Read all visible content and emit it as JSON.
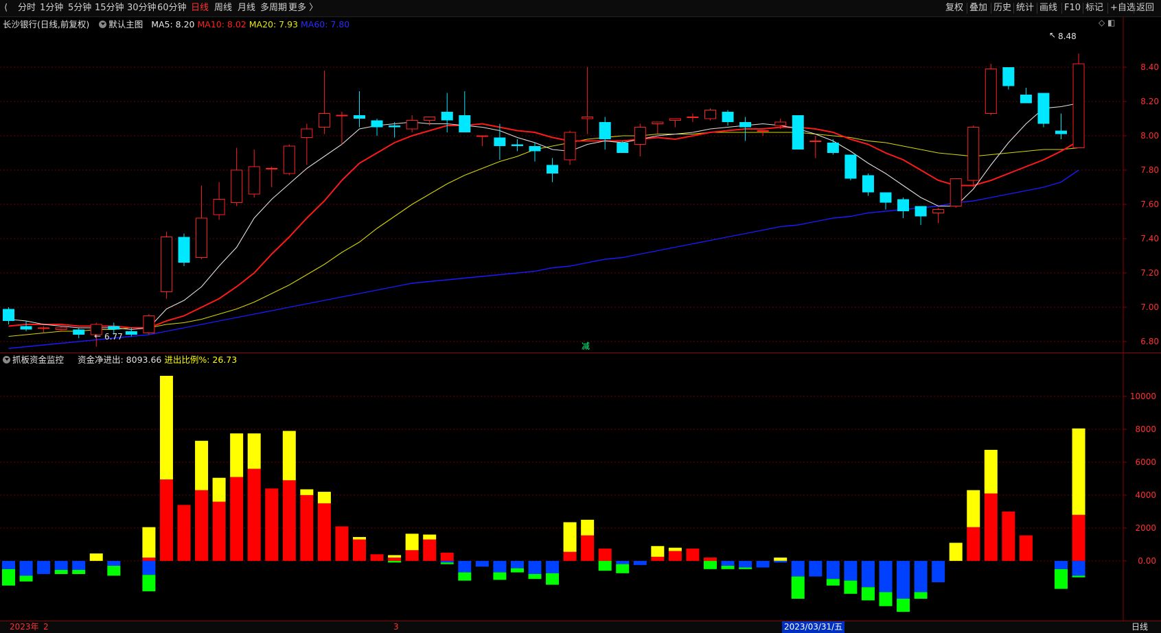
{
  "toolbar": {
    "periods": [
      "分时",
      "1分钟",
      "5分钟",
      "15分钟",
      "30分钟",
      "60分钟",
      "日线",
      "周线",
      "月线",
      "多周期",
      "更多 〉"
    ],
    "active_period": "日线",
    "right_buttons": [
      "复权",
      "叠加",
      "历史",
      "统计",
      "画线",
      "F10",
      "标记",
      "+自选",
      "返回"
    ]
  },
  "legend": {
    "stock": "长沙银行(日线,前复权)",
    "template": "默认主图",
    "ma5": "MA5: 8.20",
    "ma10": "MA10: 8.02",
    "ma20": "MA20: 7.93",
    "ma60": "MA60: 7.80",
    "sub_name": "抓板资金监控",
    "sub_net": "资金净进出: 8093.66",
    "sub_ratio": "进出比例%: 26.73"
  },
  "annotations": {
    "high_label": "8.48",
    "low_label": "6.77",
    "marker": "减"
  },
  "bottom": {
    "year": "2023年",
    "m2": "2",
    "m3": "3",
    "cursor_date": "2023/03/31/五",
    "period": "日线"
  },
  "colors": {
    "up": "#ff2020",
    "down": "#00e8ff",
    "ma5": "#e0e0e0",
    "ma10": "#ff1a1a",
    "ma20": "#d8d800",
    "ma60": "#1a1aff",
    "bar_red": "#ff0000",
    "bar_yellow": "#ffff00",
    "bar_blue": "#0040ff",
    "bar_green": "#00ff00"
  },
  "chart_data": [
    {
      "type": "candlestick",
      "title": "长沙银行(日线,前复权)",
      "y_ticks": [
        "8.40",
        "8.20",
        "8.00",
        "7.80",
        "7.60",
        "7.40",
        "7.20",
        "7.00",
        "6.80"
      ],
      "ylim": [
        6.74,
        8.56
      ],
      "ohlc": [
        [
          6.99,
          7.0,
          6.9,
          6.92
        ],
        [
          6.89,
          6.92,
          6.86,
          6.87
        ],
        [
          6.88,
          6.89,
          6.85,
          6.88
        ],
        [
          6.87,
          6.89,
          6.86,
          6.88
        ],
        [
          6.87,
          6.88,
          6.82,
          6.84
        ],
        [
          6.84,
          6.91,
          6.77,
          6.9
        ],
        [
          6.89,
          6.91,
          6.84,
          6.87
        ],
        [
          6.86,
          6.88,
          6.83,
          6.84
        ],
        [
          6.85,
          6.96,
          6.84,
          6.95
        ],
        [
          7.09,
          7.44,
          7.05,
          7.41
        ],
        [
          7.41,
          7.43,
          7.24,
          7.26
        ],
        [
          7.29,
          7.71,
          7.28,
          7.52
        ],
        [
          7.54,
          7.73,
          7.51,
          7.63
        ],
        [
          7.61,
          7.93,
          7.59,
          7.8
        ],
        [
          7.66,
          7.92,
          7.64,
          7.82
        ],
        [
          7.81,
          7.82,
          7.7,
          7.81
        ],
        [
          7.78,
          7.95,
          7.77,
          7.94
        ],
        [
          7.99,
          8.07,
          7.83,
          8.04
        ],
        [
          8.05,
          8.38,
          8.01,
          8.13
        ],
        [
          8.12,
          8.14,
          7.95,
          8.12
        ],
        [
          8.12,
          8.26,
          8.05,
          8.1
        ],
        [
          8.09,
          8.1,
          8.0,
          8.05
        ],
        [
          8.06,
          8.08,
          7.99,
          8.05
        ],
        [
          8.04,
          8.12,
          8.02,
          8.09
        ],
        [
          8.09,
          8.11,
          8.06,
          8.11
        ],
        [
          8.14,
          8.25,
          8.02,
          8.09
        ],
        [
          8.12,
          8.26,
          8.08,
          8.02
        ],
        [
          8.0,
          8.0,
          7.94,
          8.0
        ],
        [
          7.99,
          8.07,
          7.86,
          7.94
        ],
        [
          7.95,
          7.98,
          7.91,
          7.94
        ],
        [
          7.94,
          7.96,
          7.85,
          7.91
        ],
        [
          7.83,
          7.87,
          7.73,
          7.78
        ],
        [
          7.86,
          8.03,
          7.83,
          8.02
        ],
        [
          8.1,
          8.4,
          8.01,
          8.11
        ],
        [
          8.08,
          8.11,
          7.92,
          7.98
        ],
        [
          7.96,
          7.97,
          7.9,
          7.9
        ],
        [
          7.95,
          8.07,
          7.88,
          8.05
        ],
        [
          8.07,
          8.08,
          8.01,
          8.08
        ],
        [
          8.09,
          8.1,
          8.05,
          8.1
        ],
        [
          8.11,
          8.13,
          8.08,
          8.11
        ],
        [
          8.1,
          8.16,
          8.09,
          8.15
        ],
        [
          8.14,
          8.15,
          8.06,
          8.08
        ],
        [
          8.08,
          8.11,
          7.97,
          8.05
        ],
        [
          8.03,
          8.03,
          8.0,
          8.03
        ],
        [
          8.06,
          8.1,
          8.04,
          8.08
        ],
        [
          8.12,
          8.12,
          7.92,
          7.92
        ],
        [
          7.97,
          8.0,
          7.87,
          7.97
        ],
        [
          7.96,
          7.98,
          7.89,
          7.9
        ],
        [
          7.89,
          7.89,
          7.74,
          7.75
        ],
        [
          7.77,
          7.78,
          7.65,
          7.67
        ],
        [
          7.67,
          7.67,
          7.57,
          7.61
        ],
        [
          7.63,
          7.64,
          7.52,
          7.56
        ],
        [
          7.59,
          7.59,
          7.48,
          7.53
        ],
        [
          7.55,
          7.58,
          7.49,
          7.57
        ],
        [
          7.59,
          7.75,
          7.58,
          7.75
        ],
        [
          7.74,
          8.06,
          7.7,
          8.05
        ],
        [
          8.13,
          8.42,
          8.12,
          8.39
        ],
        [
          8.4,
          8.4,
          8.27,
          8.29
        ],
        [
          8.24,
          8.28,
          8.2,
          8.19
        ],
        [
          8.25,
          8.25,
          8.05,
          8.07
        ],
        [
          8.03,
          8.13,
          7.98,
          8.01
        ],
        [
          7.93,
          8.48,
          7.93,
          8.42
        ]
      ],
      "ma": {
        "MA5": [
          6.93,
          6.92,
          6.9,
          6.89,
          6.88,
          6.88,
          6.88,
          6.87,
          6.88,
          6.99,
          7.04,
          7.12,
          7.24,
          7.35,
          7.52,
          7.63,
          7.72,
          7.81,
          7.88,
          7.95,
          8.04,
          8.06,
          8.07,
          8.08,
          8.07,
          8.07,
          8.06,
          8.05,
          8.03,
          7.99,
          7.96,
          7.92,
          7.91,
          7.95,
          7.97,
          7.96,
          7.98,
          8.0,
          8.01,
          8.02,
          8.04,
          8.05,
          8.06,
          8.07,
          8.06,
          8.04,
          8.01,
          7.97,
          7.91,
          7.84,
          7.78,
          7.71,
          7.64,
          7.59,
          7.59,
          7.69,
          7.83,
          7.96,
          8.07,
          8.16,
          8.17,
          8.19
        ],
        "MA10": [
          6.89,
          6.9,
          6.9,
          6.9,
          6.89,
          6.89,
          6.89,
          6.88,
          6.88,
          6.92,
          6.95,
          7.0,
          7.05,
          7.12,
          7.2,
          7.31,
          7.41,
          7.52,
          7.62,
          7.74,
          7.84,
          7.9,
          7.96,
          8.0,
          8.03,
          8.06,
          8.06,
          8.07,
          8.05,
          8.03,
          8.02,
          7.99,
          7.97,
          7.97,
          7.97,
          7.97,
          7.98,
          7.99,
          7.98,
          8.0,
          8.02,
          8.03,
          8.04,
          8.04,
          8.05,
          8.05,
          8.04,
          8.02,
          7.98,
          7.95,
          7.9,
          7.86,
          7.8,
          7.74,
          7.71,
          7.71,
          7.74,
          7.78,
          7.82,
          7.86,
          7.91,
          7.97
        ],
        "MA20": [
          6.83,
          6.84,
          6.85,
          6.86,
          6.86,
          6.87,
          6.87,
          6.88,
          6.88,
          6.9,
          6.91,
          6.93,
          6.96,
          6.99,
          7.03,
          7.08,
          7.13,
          7.19,
          7.25,
          7.32,
          7.38,
          7.46,
          7.53,
          7.6,
          7.66,
          7.72,
          7.77,
          7.81,
          7.85,
          7.88,
          7.92,
          7.94,
          7.96,
          7.98,
          7.99,
          8.0,
          8.0,
          8.01,
          8.01,
          8.01,
          8.02,
          8.02,
          8.02,
          8.02,
          8.02,
          8.02,
          8.01,
          8.0,
          7.99,
          7.97,
          7.96,
          7.94,
          7.92,
          7.9,
          7.89,
          7.88,
          7.89,
          7.9,
          7.91,
          7.92,
          7.92,
          7.93
        ],
        "MA60": [
          6.76,
          6.77,
          6.78,
          6.79,
          6.8,
          6.81,
          6.82,
          6.83,
          6.84,
          6.86,
          6.88,
          6.9,
          6.92,
          6.94,
          6.96,
          6.98,
          7.0,
          7.02,
          7.04,
          7.06,
          7.08,
          7.1,
          7.12,
          7.14,
          7.15,
          7.16,
          7.17,
          7.18,
          7.19,
          7.2,
          7.21,
          7.23,
          7.24,
          7.26,
          7.28,
          7.29,
          7.31,
          7.33,
          7.35,
          7.37,
          7.39,
          7.41,
          7.43,
          7.45,
          7.47,
          7.48,
          7.5,
          7.52,
          7.53,
          7.55,
          7.56,
          7.57,
          7.58,
          7.59,
          7.61,
          7.62,
          7.64,
          7.66,
          7.68,
          7.7,
          7.73,
          7.8
        ]
      }
    },
    {
      "type": "bar",
      "title": "抓板资金监控",
      "y_ticks": [
        "10000",
        "8000",
        "6000",
        "4000",
        "2000",
        "0.00"
      ],
      "ylim": [
        -3300,
        12000
      ],
      "series": [
        {
          "name": "red",
          "values": [
            0,
            0,
            0,
            0,
            0,
            0,
            0,
            0,
            200,
            4950,
            3400,
            4300,
            3600,
            5100,
            5600,
            4400,
            4900,
            4000,
            3500,
            2100,
            1300,
            400,
            200,
            650,
            1300,
            500,
            0,
            0,
            0,
            0,
            0,
            0,
            550,
            1550,
            750,
            0,
            0,
            250,
            600,
            750,
            200,
            0,
            0,
            0,
            0,
            0,
            0,
            0,
            0,
            0,
            0,
            0,
            0,
            0,
            0,
            2050,
            4100,
            3000,
            1550,
            0,
            0,
            2800
          ]
        },
        {
          "name": "yellow",
          "values": [
            0,
            0,
            0,
            0,
            0,
            450,
            0,
            0,
            1850,
            6300,
            0,
            3000,
            1450,
            2650,
            2150,
            0,
            3000,
            350,
            700,
            0,
            150,
            0,
            150,
            1000,
            300,
            0,
            0,
            0,
            0,
            0,
            0,
            0,
            1800,
            950,
            0,
            0,
            0,
            650,
            200,
            0,
            0,
            0,
            0,
            0,
            200,
            0,
            0,
            0,
            0,
            0,
            0,
            0,
            0,
            0,
            1100,
            2250,
            2650,
            0,
            0,
            0,
            0,
            5250
          ]
        },
        {
          "name": "blue",
          "values": [
            -500,
            -900,
            -800,
            -550,
            -550,
            0,
            -300,
            0,
            -850,
            0,
            0,
            0,
            0,
            0,
            0,
            0,
            0,
            0,
            0,
            0,
            0,
            0,
            0,
            0,
            0,
            -100,
            -700,
            -350,
            -700,
            -450,
            -800,
            -750,
            0,
            0,
            0,
            -200,
            -250,
            0,
            0,
            0,
            0,
            -300,
            -400,
            -400,
            -100,
            -950,
            -950,
            -1100,
            -1200,
            -1600,
            -1900,
            -2300,
            -1900,
            -1300,
            0,
            0,
            0,
            0,
            0,
            0,
            -500,
            -900
          ]
        },
        {
          "name": "green",
          "values": [
            -1000,
            -350,
            0,
            -250,
            -250,
            0,
            -600,
            0,
            -1000,
            0,
            0,
            0,
            0,
            0,
            0,
            0,
            0,
            0,
            0,
            0,
            0,
            0,
            -100,
            0,
            0,
            -100,
            -500,
            0,
            -450,
            -250,
            -300,
            -700,
            0,
            0,
            -600,
            -550,
            0,
            0,
            0,
            0,
            -500,
            -200,
            -100,
            0,
            0,
            -1350,
            0,
            -400,
            -800,
            -800,
            -850,
            -800,
            -400,
            0,
            0,
            0,
            0,
            0,
            0,
            0,
            -1200,
            -100
          ]
        }
      ]
    }
  ]
}
